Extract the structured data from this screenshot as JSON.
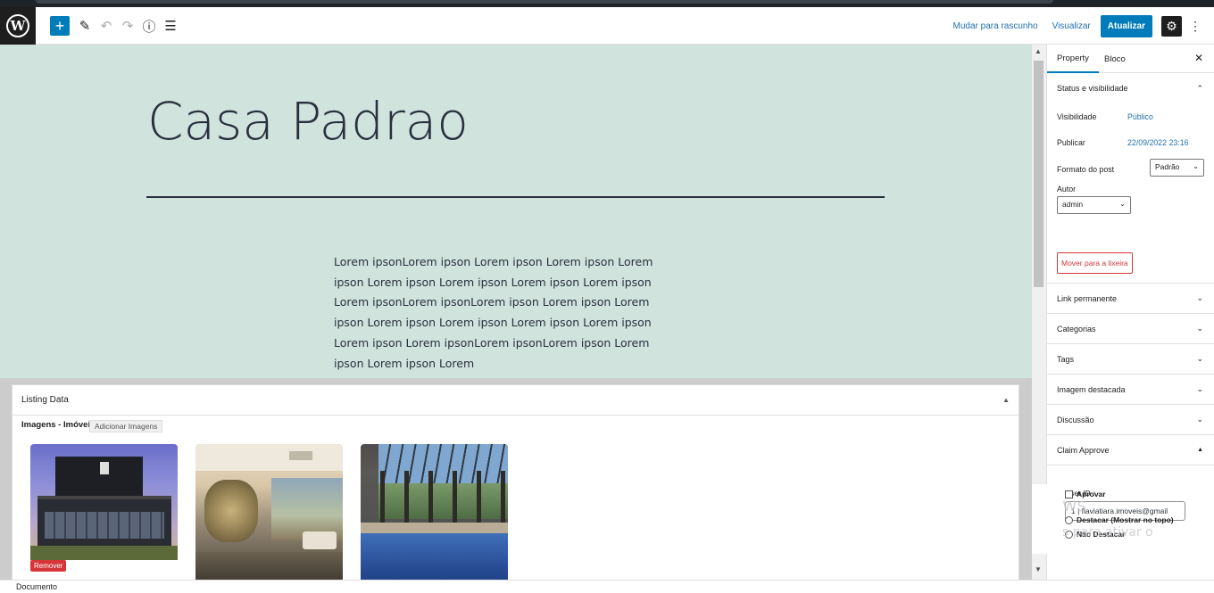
{
  "toolbar": {
    "logo": "W",
    "add_icon": "+",
    "edit_icon": "✎",
    "undo_icon": "↶",
    "redo_icon": "↷",
    "info_icon": "ⓘ",
    "list_icon": "☰",
    "draft_label": "Mudar para rascunho",
    "preview_label": "Visualizar",
    "update_label": "Atualizar",
    "settings_icon": "⚙",
    "options_icon": "⋮"
  },
  "post": {
    "title": "Casa Padrao",
    "body": "Lorem ipsonLorem ipson Lorem ipson Lorem ipson Lorem ipson Lorem ipson Lorem ipson Lorem ipson Lorem ipson Lorem ipsonLorem ipsonLorem ipson Lorem ipson Lorem ipson Lorem ipson Lorem ipson Lorem ipson Lorem ipson Lorem ipson Lorem ipsonLorem ipsonLorem ipson Lorem ipson Lorem ipson Lorem"
  },
  "metabox": {
    "title": "Listing Data",
    "toggle_icon": "▲",
    "images_label": "Imagens - Imóveis",
    "add_images_label": "Adicionar Imagens",
    "remove_label": "Remover"
  },
  "sidebar": {
    "tabs": [
      "Property",
      "Bloco"
    ],
    "close_icon": "✕",
    "status_panel": {
      "title": "Status e visibilidade",
      "visibility_label": "Visibilidade",
      "visibility_value": "Público",
      "publish_label": "Publicar",
      "publish_value": "22/09/2022 23:16",
      "format_label": "Formato do post",
      "format_value": "Padrão",
      "author_label": "Autor",
      "author_value": "admin",
      "trash_label": "Mover para a lixeira"
    },
    "panels": [
      "Link permanente",
      "Categorias",
      "Tags",
      "Imagem destacada",
      "Discussão"
    ],
    "claim_panel": {
      "title": "Claim Approve",
      "user_id_label": "User ID :",
      "user_id_value": "1 | flaviatiara.imoveis@gmail",
      "approve_label": "Aprovar",
      "highlight_label": "Destacar (Mostrar no topo)",
      "no_highlight_label": "Não Destacar"
    }
  },
  "watermark": {
    "line1": "ws",
    "line2": "s para ativar o"
  },
  "footer": {
    "label": "Documento"
  }
}
